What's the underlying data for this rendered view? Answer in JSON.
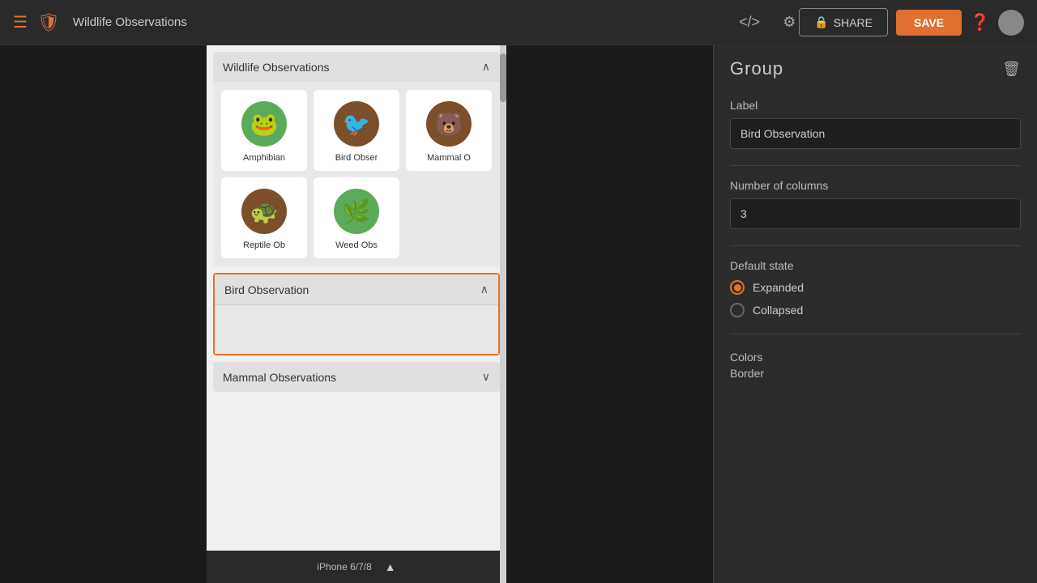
{
  "topbar": {
    "title": "Wildlife Observations",
    "code_icon": "</>",
    "settings_icon": "⚙",
    "share_label": "SHARE",
    "save_label": "SAVE"
  },
  "preview": {
    "device_label": "iPhone 6/7/8"
  },
  "wildlife_group": {
    "title": "Wildlife Observations",
    "items": [
      {
        "label": "Amphibian",
        "icon": "🐸",
        "icon_class": "icon-green"
      },
      {
        "label": "Bird Obser",
        "icon": "🐦",
        "icon_class": "icon-brown"
      },
      {
        "label": "Mammal O",
        "icon": "🐻",
        "icon_class": "icon-brown"
      },
      {
        "label": "Reptile Ob",
        "icon": "🐢",
        "icon_class": "icon-brown"
      },
      {
        "label": "Weed Obs",
        "icon": "🌿",
        "icon_class": "icon-green"
      }
    ]
  },
  "bird_group": {
    "title": "Bird Observation"
  },
  "mammal_group": {
    "title": "Mammal Observations"
  },
  "right_panel": {
    "title": "Group",
    "label_field_label": "Label",
    "label_value": "Bird Observation",
    "columns_label": "Number of columns",
    "columns_value": "3",
    "default_state_label": "Default state",
    "expanded_label": "Expanded",
    "collapsed_label": "Collapsed",
    "colors_label": "Colors",
    "border_label": "Border"
  }
}
